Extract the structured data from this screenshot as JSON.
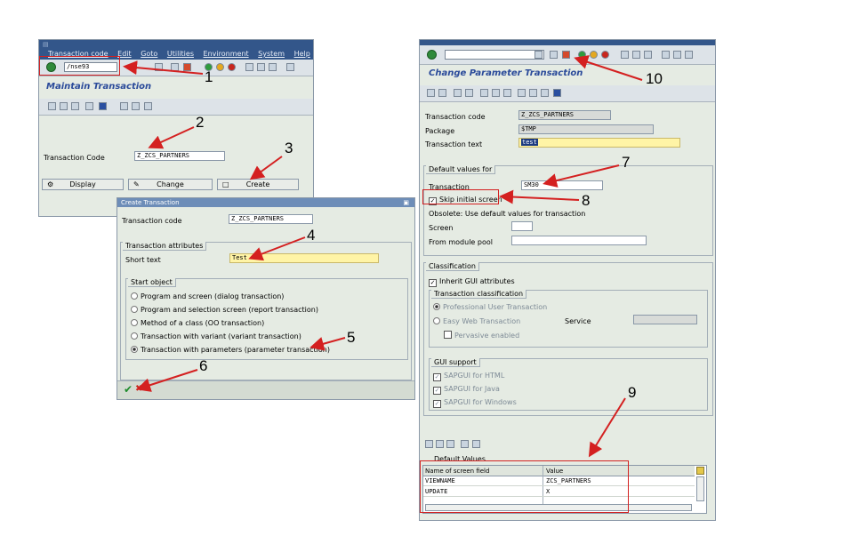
{
  "left_window": {
    "menu": [
      "Transaction code",
      "Edit",
      "Goto",
      "Utilities",
      "Environment",
      "System",
      "Help"
    ],
    "command_field": "/nse93",
    "title": "Maintain Transaction",
    "transaction_code_label": "Transaction Code",
    "transaction_code_value": "Z_ZCS_PARTNERS",
    "display_button": "Display",
    "change_button": "Change",
    "create_button": "Create"
  },
  "create_dialog": {
    "title": "Create Transaction",
    "transaction_code_label": "Transaction code",
    "transaction_code_value": "Z_ZCS_PARTNERS",
    "attributes_group": "Transaction attributes",
    "short_text_label": "Short text",
    "short_text_value": "Test",
    "start_object_group": "Start object",
    "options": [
      "Program and screen (dialog transaction)",
      "Program and selection screen (report transaction)",
      "Method of a class (OO transaction)",
      "Transaction with variant (variant transaction)",
      "Transaction with parameters (parameter transaction)"
    ],
    "selected_option": "Transaction with parameters (parameter transaction)"
  },
  "right_window": {
    "title": "Change Parameter Transaction",
    "transaction_code_label": "Transaction code",
    "transaction_code_value": "Z_ZCS_PARTNERS",
    "package_label": "Package",
    "package_value": "$TMP",
    "transaction_text_label": "Transaction text",
    "transaction_text_value": "test",
    "default_values_group": "Default values for",
    "transaction_label": "Transaction",
    "transaction_value": "SM30",
    "skip_initial_screen": "Skip initial screen",
    "obsolete_text": "Obsolete: Use default values for transaction",
    "screen_label": "Screen",
    "module_pool_label": "From module pool",
    "classification_group": "Classification",
    "inherit_gui": "Inherit GUI attributes",
    "transaction_classification_group": "Transaction classification",
    "professional_user": "Professional User Transaction",
    "easy_web": "Easy Web Transaction",
    "service_label": "Service",
    "pervasive": "Pervasive enabled",
    "gui_support_group": "GUI support",
    "gui_html": "SAPGUI for HTML",
    "gui_java": "SAPGUI for Java",
    "gui_windows": "SAPGUI for Windows",
    "default_values_table": "Default Values",
    "col_screen_field": "Name of screen field",
    "col_value": "Value",
    "rows": [
      {
        "field": "VIEWNAME",
        "value": "ZCS_PARTNERS"
      },
      {
        "field": "UPDATE",
        "value": "X"
      }
    ]
  },
  "annotations": [
    "1",
    "2",
    "3",
    "4",
    "5",
    "6",
    "7",
    "8",
    "9",
    "10"
  ],
  "colors": {
    "menubar": "#33568a",
    "title": "#2a4a9a",
    "arrow": "#d42020",
    "input_yellow": "#fff4a6"
  }
}
